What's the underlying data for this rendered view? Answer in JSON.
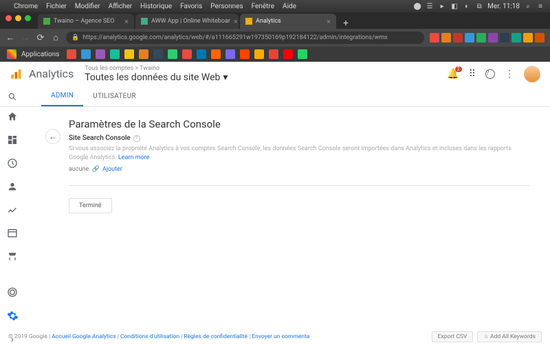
{
  "mac_menu": {
    "app": "Chrome",
    "items": [
      "Fichier",
      "Modifier",
      "Afficher",
      "Historique",
      "Favoris",
      "Personnes",
      "Fenêtre",
      "Aide"
    ],
    "clock": "Mer. 11:18"
  },
  "tabs": [
    {
      "title": "Twaino – Agence SEO",
      "active": false
    },
    {
      "title": "AWW App | Online Whiteboar",
      "active": false
    },
    {
      "title": "Analytics",
      "active": true
    }
  ],
  "url": "https://analytics.google.com/analytics/web/#/a111665291w197350169p192184122/admin/integrations/wmx",
  "bm": {
    "apps": "Applications"
  },
  "ga": {
    "product": "Analytics",
    "crumb": "Tous les comptes  >  Twaino",
    "view_title": "Toutes les données du site Web",
    "notif_count": "2",
    "tabs": {
      "admin": "ADMIN",
      "user": "UTILISATEUR"
    }
  },
  "sc": {
    "title": "Paramètres de la Search Console",
    "subtitle": "Site Search Console",
    "desc_prefix": "Si vous associez la propriété Analytics à vos comptes Search Console, les données Search Console seront importées dans Analytics et incluses dans les rapports Google Analytics. ",
    "learn_more": "Learn more",
    "status": "aucune",
    "add": "Ajouter",
    "done": "Terminé"
  },
  "footer": {
    "copyright": "© 2019 Google",
    "links": [
      "Accueil Google Analytics",
      "Conditions d'utilisation",
      "Règles de confidentialité",
      "Envoyer un commenta"
    ],
    "export": "Export CSV",
    "addkw": "Add All Keywords"
  },
  "colors": {
    "ga_orange": "#f9ab00",
    "ga_blue": "#1a73e8",
    "mac_red": "#ff5f57",
    "mac_yel": "#febc2e",
    "mac_grn": "#28c840"
  }
}
